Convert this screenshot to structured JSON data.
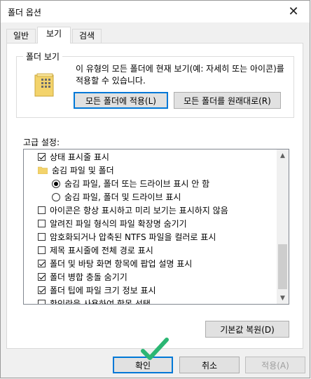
{
  "window": {
    "title": "폴더 옵션",
    "close": "✕"
  },
  "tabs": [
    {
      "label": "일반",
      "active": false
    },
    {
      "label": "보기",
      "active": true
    },
    {
      "label": "검색",
      "active": false
    }
  ],
  "folder_view": {
    "group_title": "폴더 보기",
    "description": "이 유형의 모든 폴더에 현재 보기(예: 자세히 또는 아이콘)를 적용할 수 있습니다.",
    "apply_button": "모든 폴더에 적용(L)",
    "reset_button": "모든 폴더를 원래대로(R)"
  },
  "advanced": {
    "label": "고급 설정:",
    "items": [
      {
        "type": "checkbox",
        "checked": true,
        "label": "상태 표시줄 표시",
        "indent": 1
      },
      {
        "type": "folder",
        "checked": false,
        "label": "숨김 파일 및 폴더",
        "indent": 1
      },
      {
        "type": "radio",
        "checked": true,
        "label": "숨김 파일, 폴더 또는 드라이브 표시 안 함",
        "indent": 2
      },
      {
        "type": "radio",
        "checked": false,
        "label": "숨김 파일, 폴더 및 드라이브 표시",
        "indent": 2
      },
      {
        "type": "checkbox",
        "checked": false,
        "label": "아이콘은 항상 표시하고 미리 보기는 표시하지 않음",
        "indent": 1
      },
      {
        "type": "checkbox",
        "checked": false,
        "label": "알려진 파일 형식의 파일 확장명 숨기기",
        "indent": 1
      },
      {
        "type": "checkbox",
        "checked": false,
        "label": "암호화되거나 압축된 NTFS 파일을 컬러로 표시",
        "indent": 1
      },
      {
        "type": "checkbox",
        "checked": false,
        "label": "제목 표시줄에 전체 경로 표시",
        "indent": 1
      },
      {
        "type": "checkbox",
        "checked": true,
        "label": "폴더 및 바탕 화면 항목에 팝업 설명 표시",
        "indent": 1
      },
      {
        "type": "checkbox",
        "checked": true,
        "label": "폴더 병합 충돌 숨기기",
        "indent": 1
      },
      {
        "type": "checkbox",
        "checked": true,
        "label": "폴더 팁에 파일 크기 정보 표시",
        "indent": 1
      },
      {
        "type": "checkbox",
        "checked": false,
        "label": "확인란을 사용하여 항목 선택",
        "indent": 1
      }
    ],
    "restore_button": "기본값 복원(D)"
  },
  "footer": {
    "ok": "확인",
    "cancel": "취소",
    "apply": "적용(A)"
  },
  "colors": {
    "accent": "#0078d7",
    "checkmark": "#2bb673",
    "folder": "#f3d36b"
  }
}
